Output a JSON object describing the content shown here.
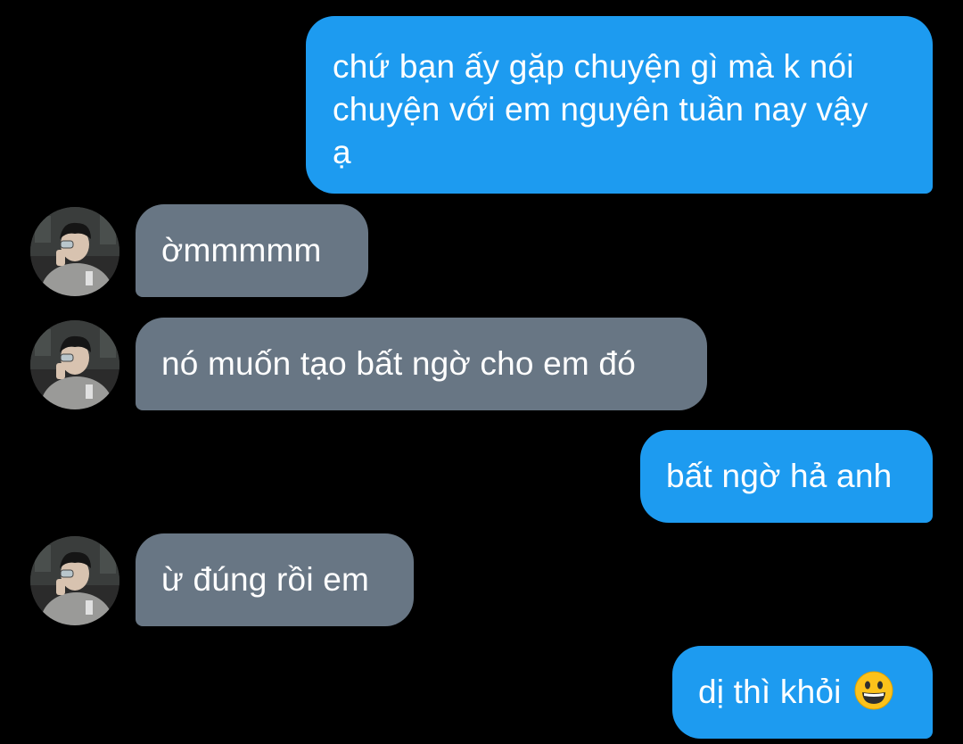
{
  "messages": [
    {
      "direction": "sent",
      "lines": [
        "chứ bạn ấy gặp chuyện gì mà k nói",
        "chuyện với em nguyên tuần nay vậy",
        "ạ"
      ]
    },
    {
      "direction": "received",
      "text": "ờmmmmm"
    },
    {
      "direction": "received",
      "text": "nó muốn tạo bất ngờ cho em đó"
    },
    {
      "direction": "sent",
      "text": "bất ngờ hả anh"
    },
    {
      "direction": "received",
      "text": "ừ đúng rồi em"
    },
    {
      "direction": "sent",
      "text": "dị thì khỏi",
      "emoji": "grinning-face"
    }
  ],
  "colors": {
    "background": "#000000",
    "sent_bubble": "#1d9bf0",
    "received_bubble": "#687684",
    "text": "#ffffff"
  }
}
